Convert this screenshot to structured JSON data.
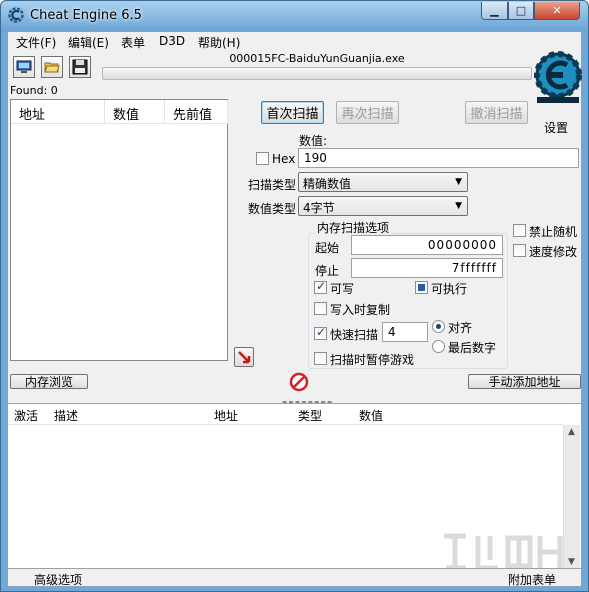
{
  "window": {
    "title": "Cheat Engine 6.5",
    "minimize": "▁",
    "maximize": "□",
    "close": "✕"
  },
  "menubar": {
    "file": "文件(F)",
    "edit": "编辑(E)",
    "table": "表单",
    "d3d": "D3D",
    "help": "帮助(H)"
  },
  "toolbar": {
    "open_process_icon": "computer-icon",
    "open_file_icon": "folder-open-icon",
    "save_icon": "floppy-disk-icon"
  },
  "process_name": "000015FC-BaiduYunGuanjia.exe",
  "found_label": "Found: 0",
  "settings_label": "设置",
  "found_list": {
    "columns": [
      "地址",
      "数值",
      "先前值"
    ]
  },
  "scan": {
    "first_scan": "首次扫描",
    "next_scan": "再次扫描",
    "undo_scan": "撤消扫描",
    "value_label": "数值:",
    "hex_label": "Hex",
    "value": "190",
    "scan_type_label": "扫描类型",
    "scan_type": "精确数值",
    "value_type_label": "数值类型",
    "value_type": "4字节"
  },
  "memory_options": {
    "title": "内存扫描选项",
    "start_label": "起始",
    "start_value": "00000000",
    "stop_label": "停止",
    "stop_value": "7fffffff",
    "writable": "可写",
    "executable": "可执行",
    "copy_on_write": "写入时复制",
    "fast_scan": "快速扫描",
    "fast_scan_value": "4",
    "alignment": "对齐",
    "last_digits": "最后数字",
    "pause_game": "扫描时暂停游戏"
  },
  "side_options": {
    "no_random": "禁止随机",
    "speed_hack": "速度修改"
  },
  "buttons": {
    "memory_view": "内存浏览",
    "add_address": "手动添加地址"
  },
  "address_list": {
    "columns": [
      "激活",
      "描述",
      "地址",
      "类型",
      "数值"
    ]
  },
  "bottom": {
    "advanced": "高级选项",
    "table_extras": "附加表单"
  },
  "colors": {
    "titlebar": "#6aa4d4",
    "client_bg": "#f0f0f0",
    "stop_icon": "#d4202a",
    "logo": "#1e8fbf"
  }
}
